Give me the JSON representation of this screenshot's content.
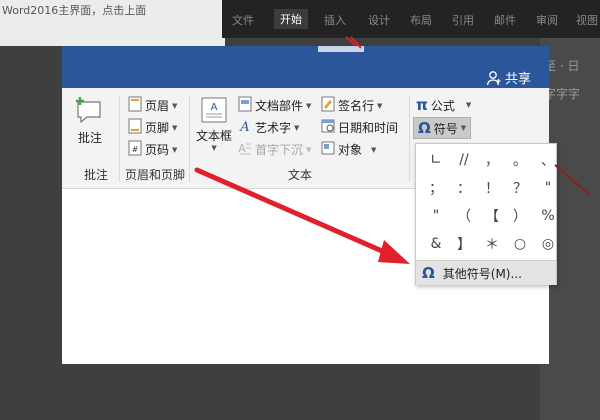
{
  "background": {
    "caption": "Word2016主界面，点击上面",
    "tabs": [
      "文件",
      "开始",
      "插入",
      "设计",
      "布局",
      "引用",
      "邮件",
      "审阅",
      "视图"
    ],
    "right_text": "至 · 日\n字字字"
  },
  "word": {
    "share_label": "共享",
    "ribbon": {
      "comment_label": "批注",
      "header_label": "页眉",
      "footer_label": "页脚",
      "page_number_label": "页码",
      "textbox_label": "文本框",
      "quick_parts_label": "文档部件",
      "wordart_label": "艺术字",
      "dropcap_label": "首字下沉",
      "signature_label": "签名行",
      "datetime_label": "日期和时间",
      "object_label": "对象",
      "equation_label": "公式",
      "symbol_label": "符号",
      "equation_glyph": "π",
      "symbol_glyph": "Ω",
      "groups": {
        "comments": "批注",
        "header_footer": "页眉和页脚",
        "text": "文本"
      }
    },
    "symbol_menu": {
      "symbols": [
        "∟",
        "//",
        "，",
        "。",
        "、",
        "；",
        "：",
        "！",
        "？",
        "\"",
        "\"",
        "（",
        "【",
        "）",
        "%",
        "&",
        "】",
        "＊",
        "○",
        "◎"
      ],
      "more_label": "其他符号(M)..."
    }
  },
  "colors": {
    "word_blue": "#2b579a",
    "arrow_red": "#e0202a"
  }
}
